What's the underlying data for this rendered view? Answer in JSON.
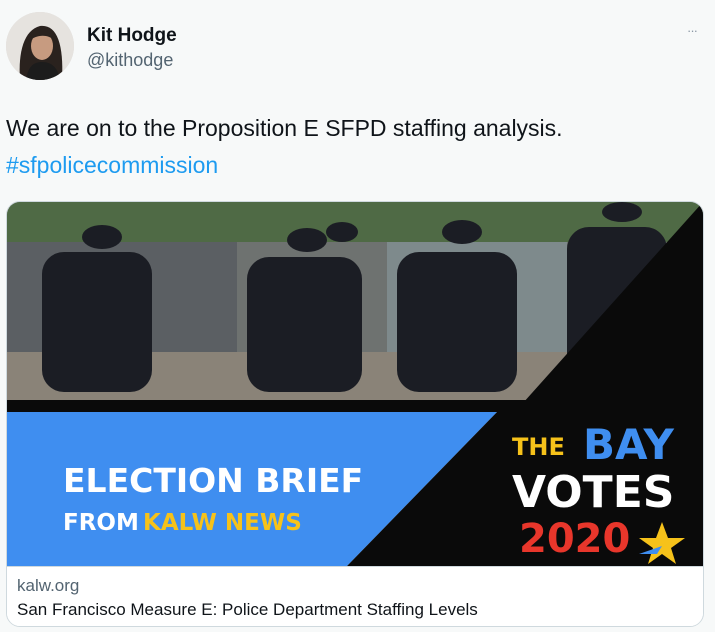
{
  "author": {
    "name": "Kit Hodge",
    "handle": "@kithodge"
  },
  "more_menu": "···",
  "tweet": {
    "text": "We are on to the Proposition E SFPD staffing analysis.",
    "hashtag": "#sfpolicecommission"
  },
  "card": {
    "image": {
      "left_line1": "ELECTION BRIEF",
      "left_line2_prefix": "FROM ",
      "left_line2_brand": "KALW NEWS",
      "right_the": "THE",
      "right_bay": "BAY",
      "right_votes": "VOTES",
      "right_year": "2020"
    },
    "domain": "kalw.org",
    "title": "San Francisco Measure E: Police Department Staffing Levels"
  },
  "colors": {
    "banner_blue": "#3f8ef0",
    "banner_black": "#0a0a0a",
    "brand_yellow": "#f6c21a",
    "year_red": "#e8362b",
    "link_blue": "#1d9bf0"
  }
}
